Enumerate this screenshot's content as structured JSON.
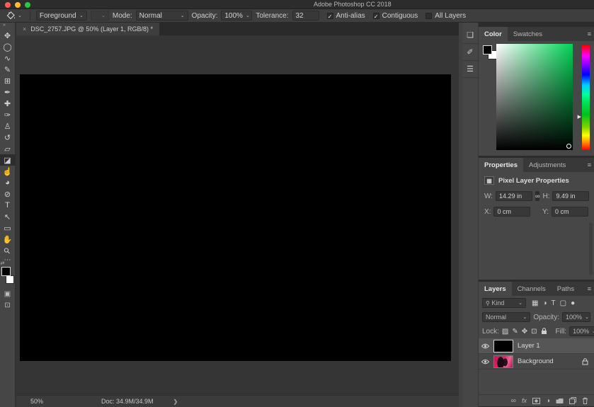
{
  "window": {
    "title": "Adobe Photoshop CC 2018"
  },
  "colors": {
    "traffic_close": "#ff5f57",
    "traffic_minimize": "#febc2e",
    "traffic_zoom": "#28c840",
    "panel_bg": "#474747",
    "canvas": "#000000",
    "pasteboard": "#353535",
    "selected_layer_row": "#565656",
    "hue_selected_green": "#00d355"
  },
  "icons": {
    "chevron_down": "⌄",
    "check": "✓",
    "collapse": "»",
    "ellipsis": "⋯",
    "panel_menu": "≡",
    "swap_swatches": "⇄",
    "hue_arrow": "▶",
    "status_chevron": "❯",
    "search": "⚲",
    "link": "∞",
    "picture": "▦",
    "adjustment": "◑",
    "type_filter": "T",
    "shape_filter": "▢",
    "pin": "●",
    "lock_transparent": "▨",
    "lock_brush": "✎",
    "lock_position": "✥",
    "lock_artboard": "⊡",
    "quick_mask": "▣",
    "screen_mode": "⊡",
    "pixel_layer": "▦"
  },
  "options_bar": {
    "tool": "paint-bucket",
    "source_dropdown": "Foreground",
    "mode_label": "Mode:",
    "mode_value": "Normal",
    "opacity_label": "Opacity:",
    "opacity_value": "100%",
    "tolerance_label": "Tolerance:",
    "tolerance_value": "32",
    "checkboxes": [
      {
        "label": "Anti-alias",
        "checked": true
      },
      {
        "label": "Contiguous",
        "checked": true
      },
      {
        "label": "All Layers",
        "checked": false
      }
    ]
  },
  "tools": [
    {
      "name": "move",
      "glyph": "✥"
    },
    {
      "name": "elliptical-marquee",
      "glyph": "◯"
    },
    {
      "name": "lasso",
      "glyph": "∿"
    },
    {
      "name": "quick-selection",
      "glyph": "✎"
    },
    {
      "name": "crop",
      "glyph": "⊞"
    },
    {
      "name": "eyedropper",
      "glyph": "✒"
    },
    {
      "name": "spot-healing-brush",
      "glyph": "✚"
    },
    {
      "name": "brush",
      "glyph": "✑"
    },
    {
      "name": "clone-stamp",
      "glyph": "♙"
    },
    {
      "name": "history-brush",
      "glyph": "↺"
    },
    {
      "name": "eraser",
      "glyph": "▱"
    },
    {
      "name": "paint-bucket",
      "glyph": "◪",
      "selected": true
    },
    {
      "name": "smudge",
      "glyph": "☝"
    },
    {
      "name": "dodge",
      "glyph": "◕"
    },
    {
      "name": "pen",
      "glyph": "⊘"
    },
    {
      "name": "type",
      "glyph": "T"
    },
    {
      "name": "path-selection",
      "glyph": "↖"
    },
    {
      "name": "rectangle",
      "glyph": "▭"
    },
    {
      "name": "hand",
      "glyph": "✋"
    },
    {
      "name": "zoom",
      "glyph": "⚲"
    }
  ],
  "document": {
    "tab_title": "DSC_2757.JPG @ 50% (Layer 1, RGB/8) *",
    "close_glyph": "×",
    "zoom_level": "50%",
    "doc_size": "Doc: 34.9M/34.9M"
  },
  "dock_icons": [
    {
      "name": "history",
      "glyph": "❏"
    },
    {
      "name": "brush-settings",
      "glyph": "✐"
    },
    {
      "name": "tool-presets",
      "glyph": "☰"
    }
  ],
  "panels": {
    "color": {
      "tabs": [
        "Color",
        "Swatches"
      ],
      "active_tab": "Color"
    },
    "properties": {
      "tabs": [
        "Properties",
        "Adjustments"
      ],
      "active_tab": "Properties",
      "header": "Pixel Layer Properties",
      "w_label": "W:",
      "w_value": "14.29 in",
      "h_label": "H:",
      "h_value": "9.49 in",
      "x_label": "X:",
      "x_value": "0 cm",
      "y_label": "Y:",
      "y_value": "0 cm"
    },
    "layers": {
      "tabs": [
        "Layers",
        "Channels",
        "Paths"
      ],
      "active_tab": "Layers",
      "filter_label": "Kind",
      "blend_mode": "Normal",
      "opacity_label": "Opacity:",
      "opacity_value": "100%",
      "lock_label": "Lock:",
      "fill_label": "Fill:",
      "fill_value": "100%",
      "rows": [
        {
          "name": "Layer 1",
          "selected": true,
          "locked": false
        },
        {
          "name": "Background",
          "selected": false,
          "locked": true
        }
      ],
      "bottom_bar": [
        "link",
        "effects",
        "layer-mask",
        "adjustment-layer",
        "group",
        "new-layer",
        "delete"
      ]
    }
  }
}
